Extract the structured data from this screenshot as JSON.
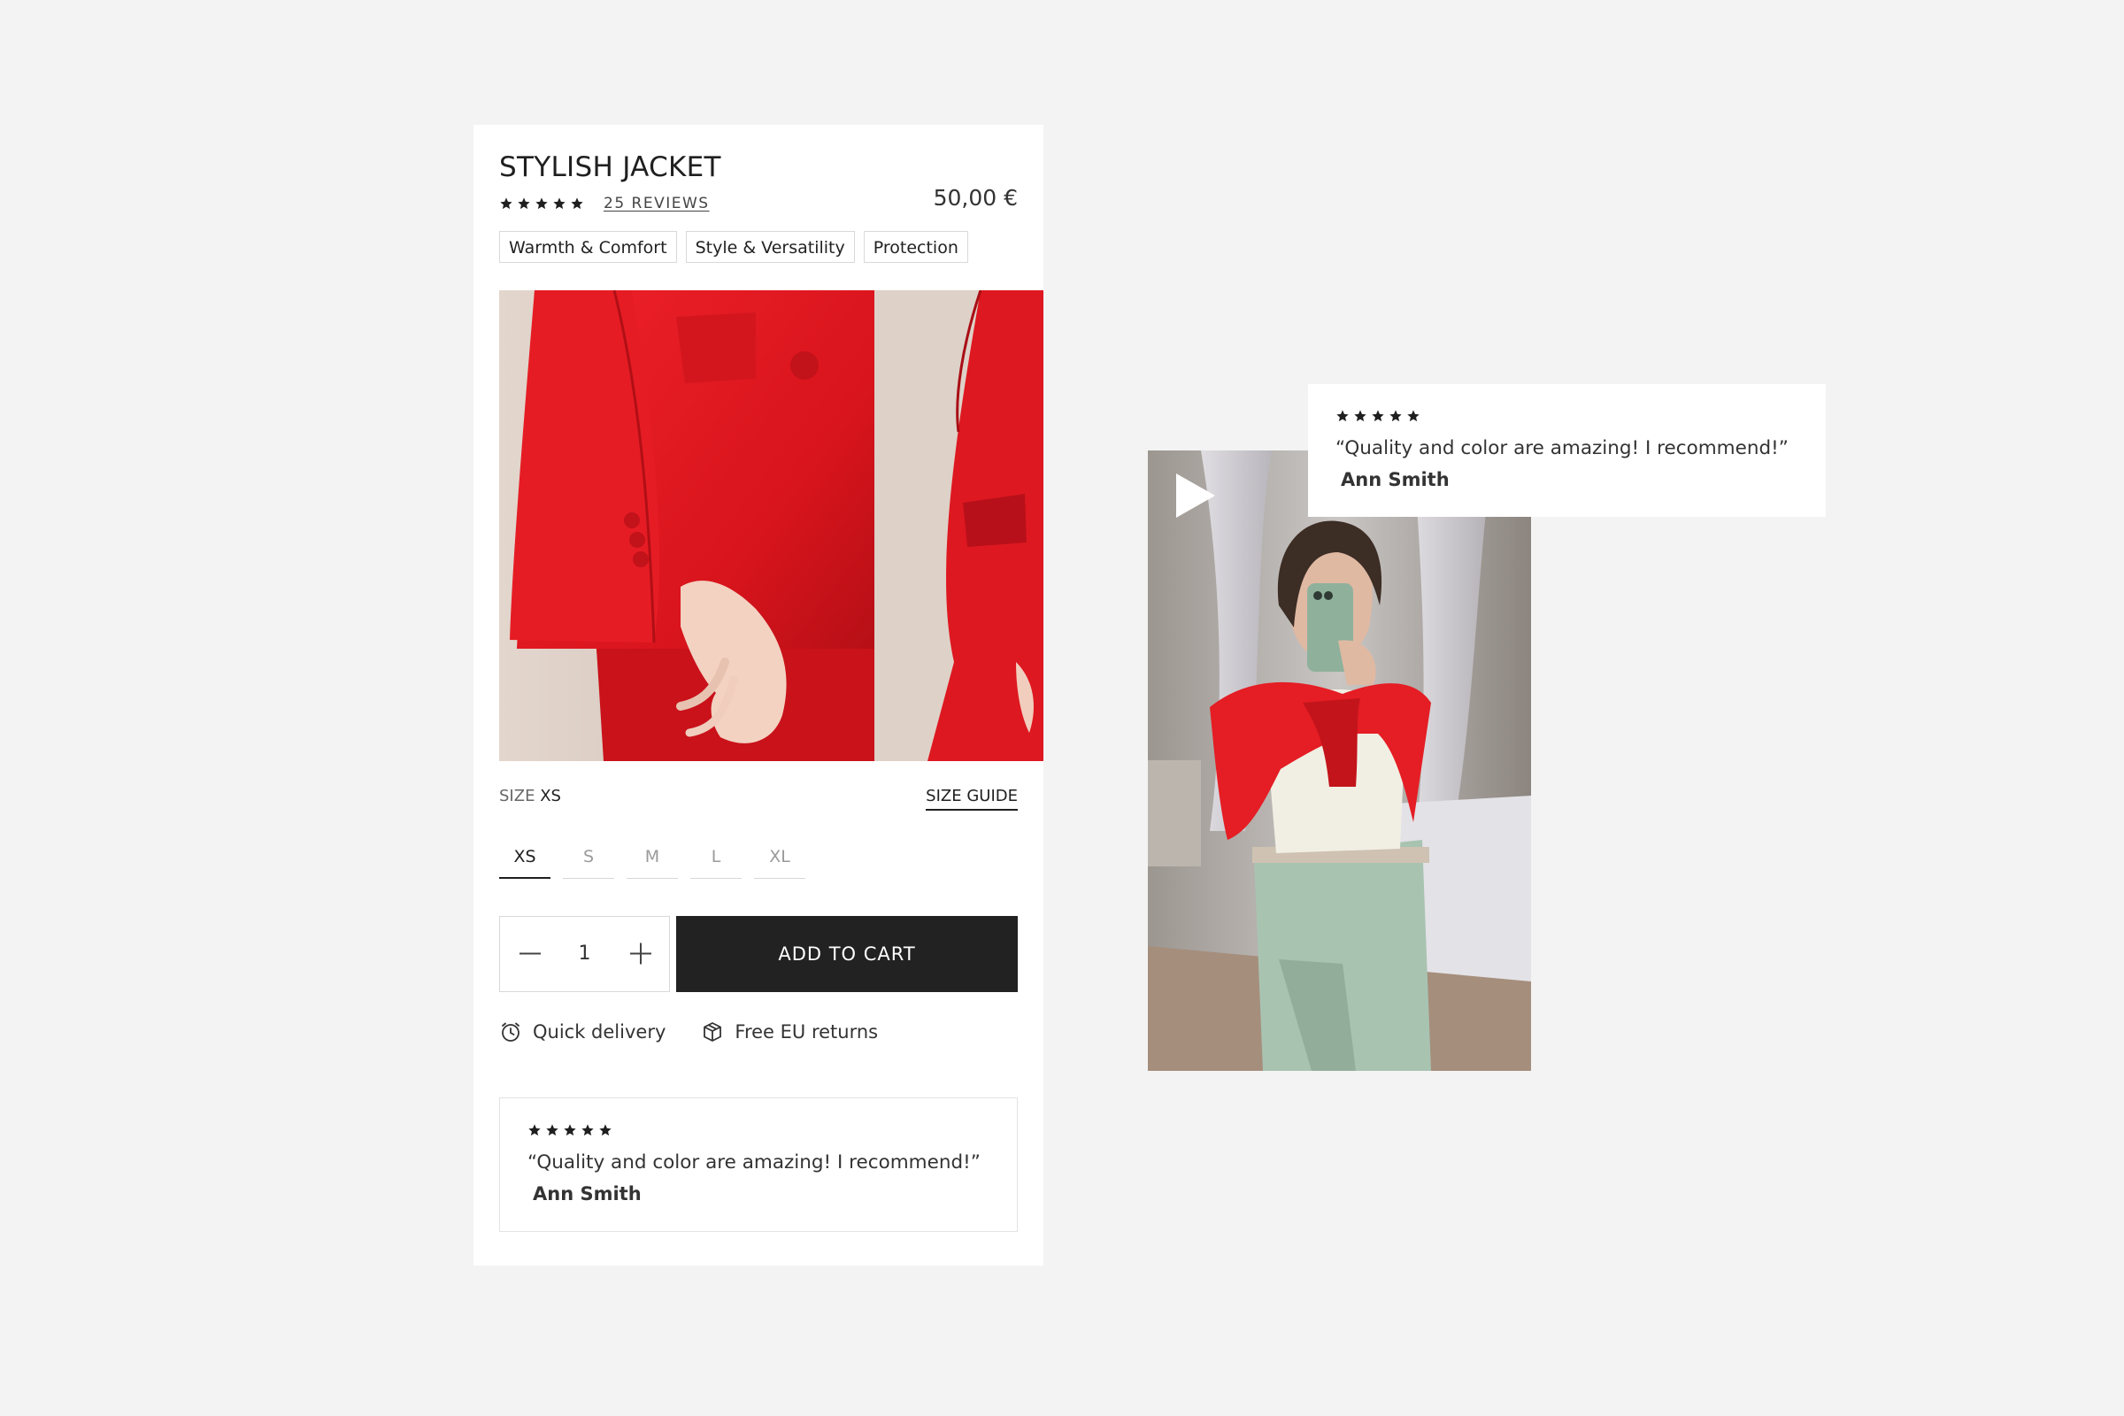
{
  "product": {
    "title": "STYLISH JACKET",
    "reviews_link": "25 REVIEWS",
    "rating_stars": 5,
    "price": "50,00 €",
    "tags": [
      "Warmth & Comfort",
      "Style & Versatility",
      "Protection"
    ]
  },
  "size": {
    "label": "SIZE",
    "selected": "XS",
    "guide": "SIZE GUIDE",
    "options": [
      "XS",
      "S",
      "M",
      "L",
      "XL"
    ]
  },
  "quantity": {
    "value": "1"
  },
  "cart": {
    "add_label": "ADD TO CART"
  },
  "features": [
    {
      "icon": "clock-icon",
      "label": "Quick delivery"
    },
    {
      "icon": "box-icon",
      "label": "Free EU returns"
    }
  ],
  "review": {
    "stars": 5,
    "quote": "“Quality and color are amazing! I recommend!”",
    "author": "Ann Smith"
  },
  "floating_review": {
    "stars": 5,
    "quote": "“Quality and color are amazing! I recommend!”",
    "author": "Ann Smith"
  },
  "colors": {
    "background": "#f3f3f3",
    "card": "#ffffff",
    "button": "#222222",
    "jacket_red": "#e01b22"
  }
}
